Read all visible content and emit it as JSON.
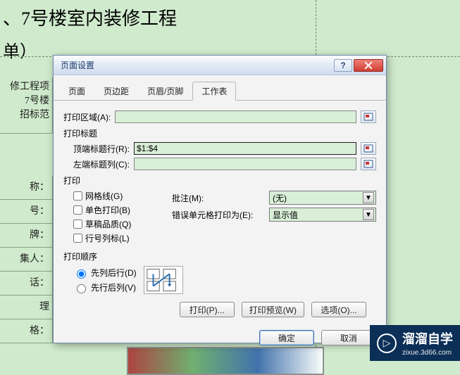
{
  "background": {
    "title_line": "、7号楼室内装修工程",
    "sub_line": "单）",
    "left_cells_block1": [
      "修工程项",
      "  7号楼",
      "招标范"
    ],
    "left_cells_block2": [
      "称：",
      "号：",
      "牌：",
      "集人：",
      "话：",
      "理",
      "格："
    ]
  },
  "dialog": {
    "title": "页面设置",
    "tabs": [
      "页面",
      "页边距",
      "页眉/页脚",
      "工作表"
    ],
    "active_tab_index": 3,
    "print_area_label": "打印区域(A):",
    "print_area_value": "",
    "print_titles_label": "打印标题",
    "top_row_label": "顶端标题行(R):",
    "top_row_value": "$1:$4",
    "left_col_label": "左端标题列(C):",
    "left_col_value": "",
    "print_group_label": "打印",
    "checks": {
      "gridlines": "网格线(G)",
      "bw": "单色打印(B)",
      "draft": "草稿品质(Q)",
      "rowcol": "行号列标(L)"
    },
    "comments_label": "批注(M):",
    "comments_value": "(无)",
    "errors_label": "错误单元格打印为(E):",
    "errors_value": "显示值",
    "order_group": "打印顺序",
    "order_down": "先列后行(D)",
    "order_over": "先行后列(V)",
    "order_selected": "down",
    "buttons": {
      "print": "打印(P)...",
      "preview": "打印预览(W)",
      "options": "选项(O)...",
      "ok": "确定",
      "cancel": "取消"
    }
  },
  "watermark": {
    "text": "溜溜自学",
    "sub": "zixue.3d66.com"
  }
}
